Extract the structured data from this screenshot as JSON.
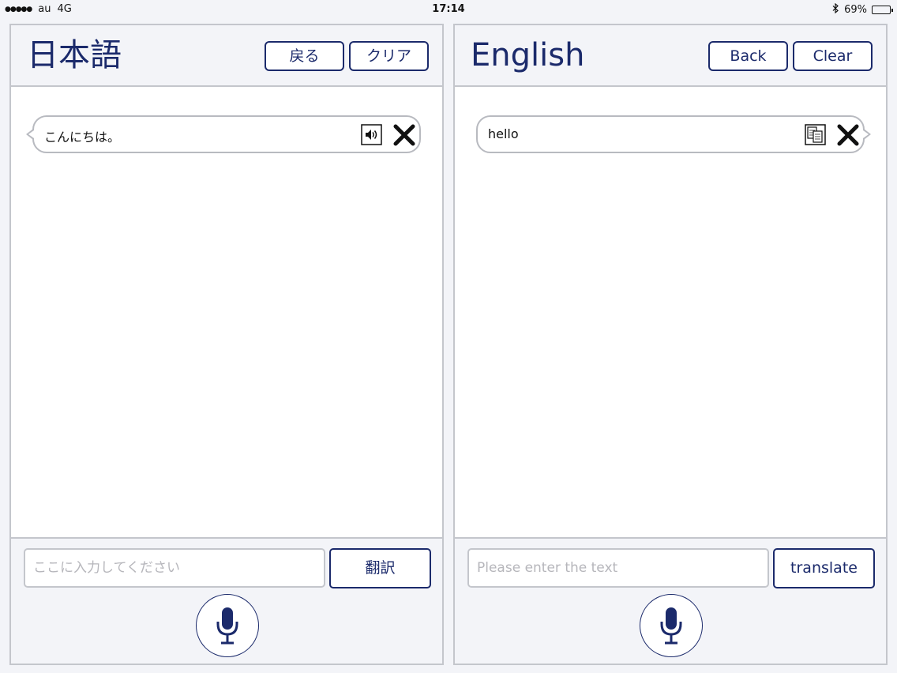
{
  "status_bar": {
    "signal": "●●●●●",
    "carrier": "au",
    "network": "4G",
    "time": "17:14",
    "battery_text": "69%",
    "battery_level": 0.69
  },
  "left_panel": {
    "title": "日本語",
    "back_label": "戻る",
    "clear_label": "クリア",
    "message_text": "こんにちは。",
    "input_value": "",
    "input_placeholder": "ここに入力してください",
    "translate_label": "翻訳",
    "message_icon": "speaker-icon"
  },
  "right_panel": {
    "title": "English",
    "back_label": "Back",
    "clear_label": "Clear",
    "message_text": "hello",
    "input_value": "",
    "input_placeholder": "Please enter the text",
    "translate_label": "translate",
    "message_icon": "copy-icon"
  },
  "colors": {
    "accent": "#1b2a6b",
    "border": "#c4c6cc",
    "background": "#f3f4f8"
  }
}
